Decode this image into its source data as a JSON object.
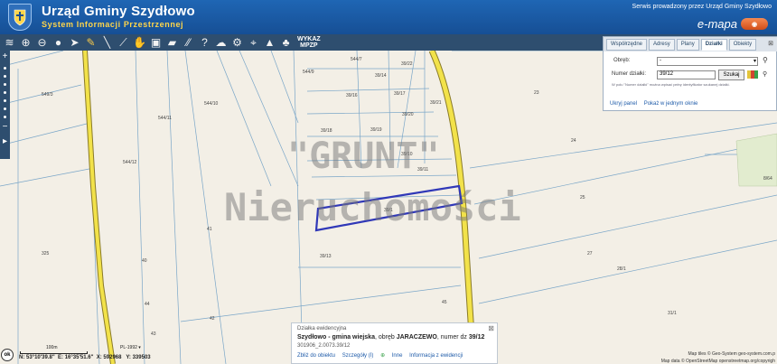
{
  "header": {
    "title": "Urząd Gminy Szydłowo",
    "subtitle": "System Informacji Przestrzennej",
    "service_text": "Serwis prowadzony przez Urząd Gminy Szydłowo",
    "emapa_text": "e-mapa",
    "brand_color": "#1a5aa6"
  },
  "toolbar": {
    "tools": [
      "layers-icon",
      "zoom-in-icon",
      "zoom-out-icon",
      "full-extent-icon",
      "pointer-icon",
      "pencil-icon",
      "measure-line-icon",
      "measure-area-icon",
      "hand-icon",
      "select-icon",
      "chat-icon",
      "help-icon",
      "marker-icon",
      "settings-icon",
      "scheme-icon",
      "streetview-icon",
      "rows-icon"
    ],
    "wykaz_line1": "WYKAZ",
    "wykaz_line2": "MPZP"
  },
  "watermark": {
    "line1": "\"GRUNT\"",
    "line2": "Nieruchomości"
  },
  "parcel_labels": [
    "544/7",
    "39/22",
    "549/3",
    "544/9",
    "39/14",
    "23",
    "544/10",
    "39/16",
    "39/17",
    "39/21",
    "544/11",
    "39/20",
    "39/18",
    "39/19",
    "24",
    "544/12",
    "39/10",
    "39/11",
    "25",
    "39/1",
    "41",
    "325",
    "40",
    "39/13",
    "27",
    "28/1",
    "44",
    "42",
    "45",
    "43",
    "31/1",
    "8/64"
  ],
  "panel": {
    "tabs": [
      "Współrzędne",
      "Adresy",
      "Plany",
      "Działki",
      "Obiekty"
    ],
    "active_tab": "Działki",
    "obreb_label": "Obręb:",
    "obreb_value": "-",
    "numer_label": "Numer działki:",
    "numer_value": "39/12",
    "search_button": "Szukaj",
    "hint": "W polu \"Numer działki\" można wpisać pełny identyfikator szukanej działki.",
    "link_hide": "Ukryj panel",
    "link_window": "Pokaż w jednym oknie"
  },
  "infobox": {
    "heading": "Działka ewidencyjna",
    "line1_a": "Szydłowo - gmina wiejska",
    "line1_b": ", obręb ",
    "line1_c": "JARACZEWO",
    "line1_d": ", numer dz ",
    "line1_e": "39/12",
    "line2": "301906_2.0073.39/12",
    "links": [
      "Zbliż do obiektu",
      "Szczegóły (I)",
      "Inne",
      "Informacja z ewidencji"
    ]
  },
  "scale": {
    "label": "100m",
    "crs": "PL-1992",
    "ok": "ok",
    "coords_n": "N: 53°10'39.8\"",
    "coords_e": "E: 16°35'51.6\"",
    "coords_x": "X: 592968",
    "coords_y": "Y: 339503"
  },
  "attribution": {
    "line1": "Map tiles © Geo-System geo-system.com.p",
    "line2": "Map data © OpenStreetMap openstreetmap.org/copyrigh"
  },
  "colors": {
    "road": "#f2e24a",
    "highlight": "#3038b8",
    "parcel_line": "#7aa6c8"
  }
}
